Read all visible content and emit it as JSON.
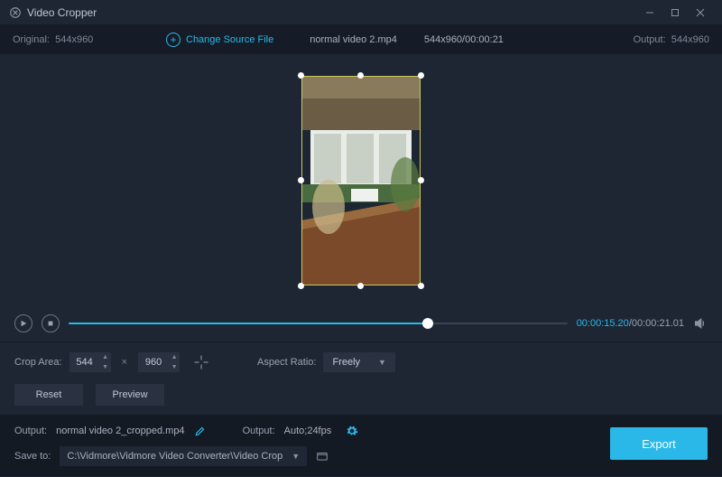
{
  "titlebar": {
    "title": "Video Cropper"
  },
  "sourcebar": {
    "original_label": "Original:",
    "original_dims": "544x960",
    "change_source_label": "Change Source File",
    "filename": "normal video 2.mp4",
    "dims_duration": "544x960/00:00:21",
    "output_label": "Output:",
    "output_dims": "544x960"
  },
  "playback": {
    "current_time": "00:00:15.20",
    "total_time": "00:00:21.01",
    "progress_pct": 72
  },
  "crop": {
    "area_label": "Crop Area:",
    "width": "544",
    "height": "960",
    "aspect_label": "Aspect Ratio:",
    "aspect_value": "Freely"
  },
  "buttons": {
    "reset": "Reset",
    "preview": "Preview",
    "export": "Export"
  },
  "output": {
    "label1": "Output:",
    "filename": "normal video 2_cropped.mp4",
    "label2": "Output:",
    "spec": "Auto;24fps"
  },
  "save": {
    "label": "Save to:",
    "path": "C:\\Vidmore\\Vidmore Video Converter\\Video Crop"
  }
}
